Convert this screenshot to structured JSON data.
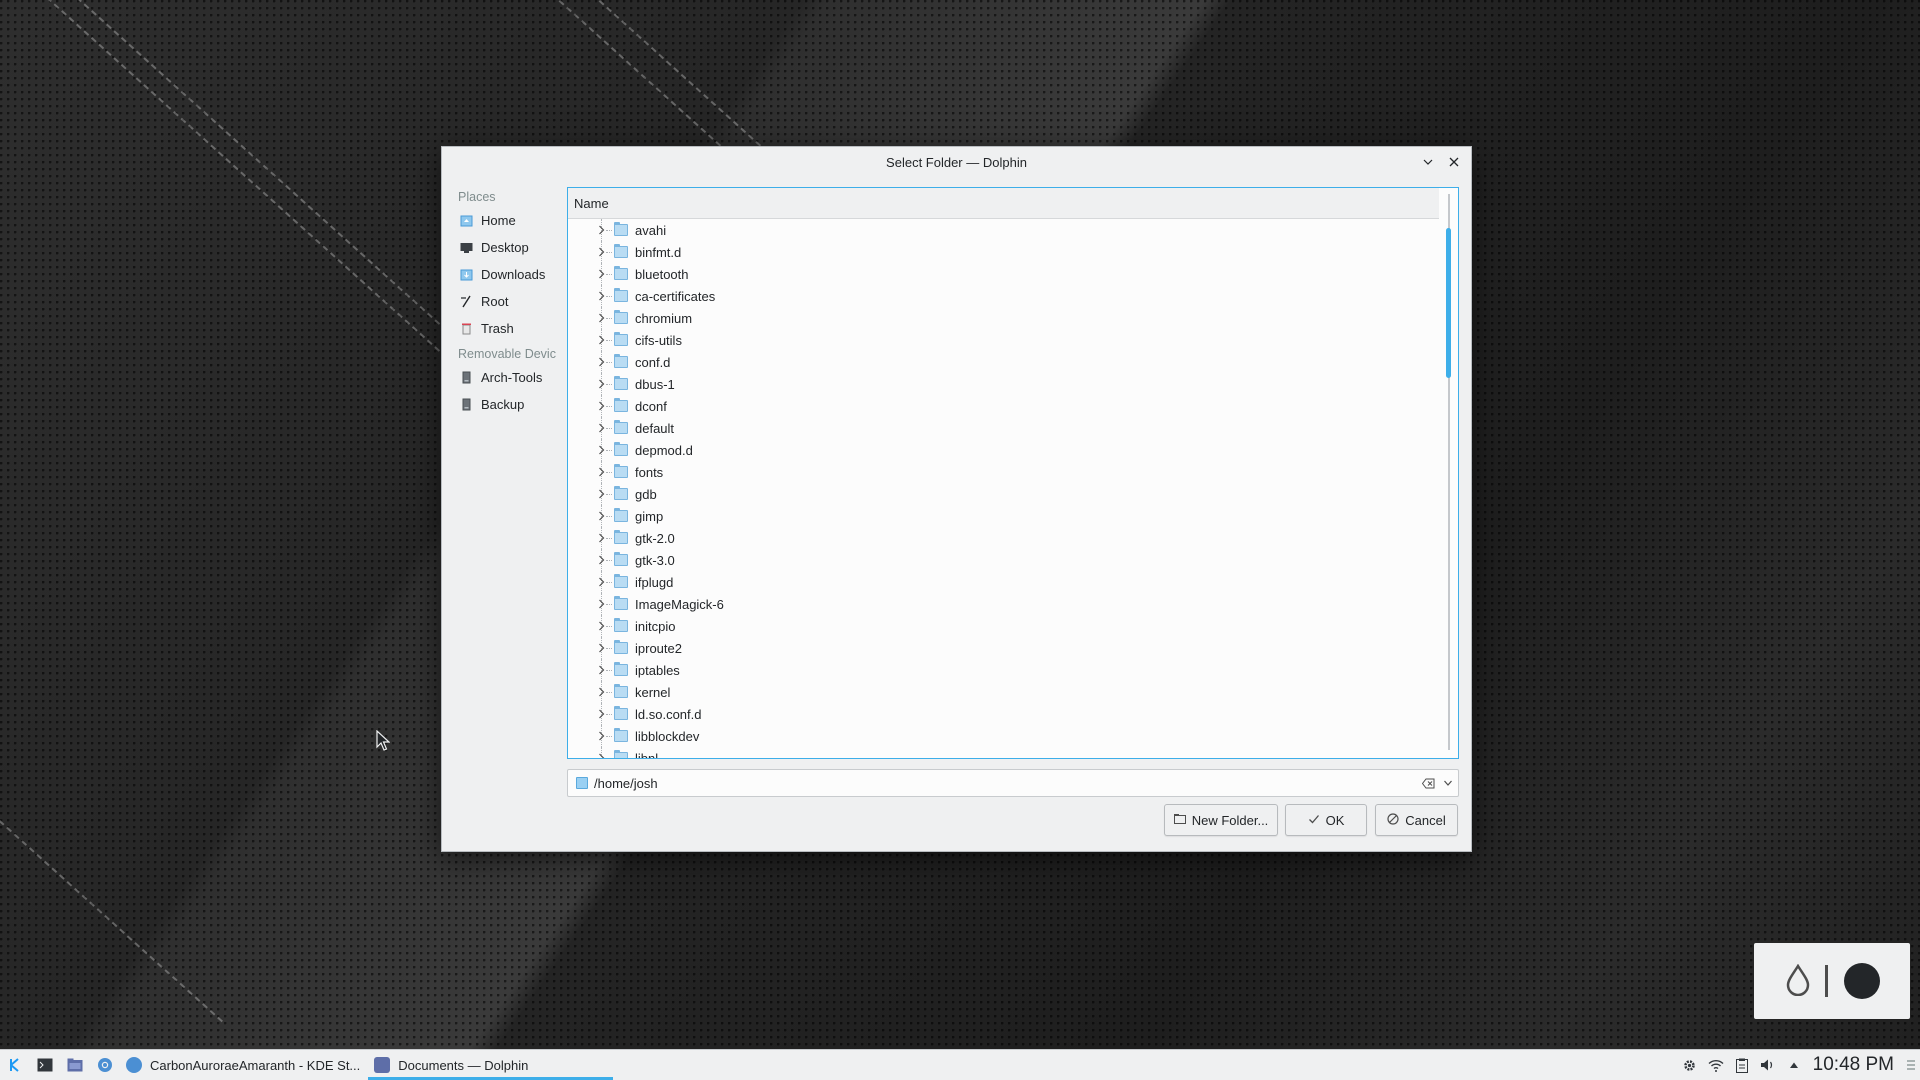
{
  "dialog": {
    "title": "Select Folder — Dolphin"
  },
  "places": {
    "header": "Places",
    "items": [
      {
        "label": "Home",
        "icon": "home-icon"
      },
      {
        "label": "Desktop",
        "icon": "desktop-icon"
      },
      {
        "label": "Downloads",
        "icon": "downloads-icon"
      },
      {
        "label": "Root",
        "icon": "root-icon"
      },
      {
        "label": "Trash",
        "icon": "trash-icon"
      }
    ],
    "removable_header": "Removable Devic",
    "removable_items": [
      {
        "label": "Arch-Tools",
        "icon": "drive-icon"
      },
      {
        "label": "Backup",
        "icon": "drive-icon"
      }
    ]
  },
  "tree": {
    "column_header": "Name",
    "folders": [
      "avahi",
      "binfmt.d",
      "bluetooth",
      "ca-certificates",
      "chromium",
      "cifs-utils",
      "conf.d",
      "dbus-1",
      "dconf",
      "default",
      "depmod.d",
      "fonts",
      "gdb",
      "gimp",
      "gtk-2.0",
      "gtk-3.0",
      "ifplugd",
      "ImageMagick-6",
      "initcpio",
      "iproute2",
      "iptables",
      "kernel",
      "ld.so.conf.d",
      "libblockdev",
      "libnl"
    ]
  },
  "pathbar": {
    "value": "/home/josh"
  },
  "buttons": {
    "new_folder": "New Folder...",
    "ok": "OK",
    "cancel": "Cancel"
  },
  "taskbar": {
    "tasks": [
      {
        "label": "CarbonAuroraeAmaranth - KDE St...",
        "active": false
      },
      {
        "label": "Documents — Dolphin",
        "active": true
      }
    ],
    "clock": "10:48 PM"
  },
  "colors": {
    "accent": "#3daee9",
    "window_bg": "#eff0f1",
    "view_bg": "#fcfcfc"
  }
}
